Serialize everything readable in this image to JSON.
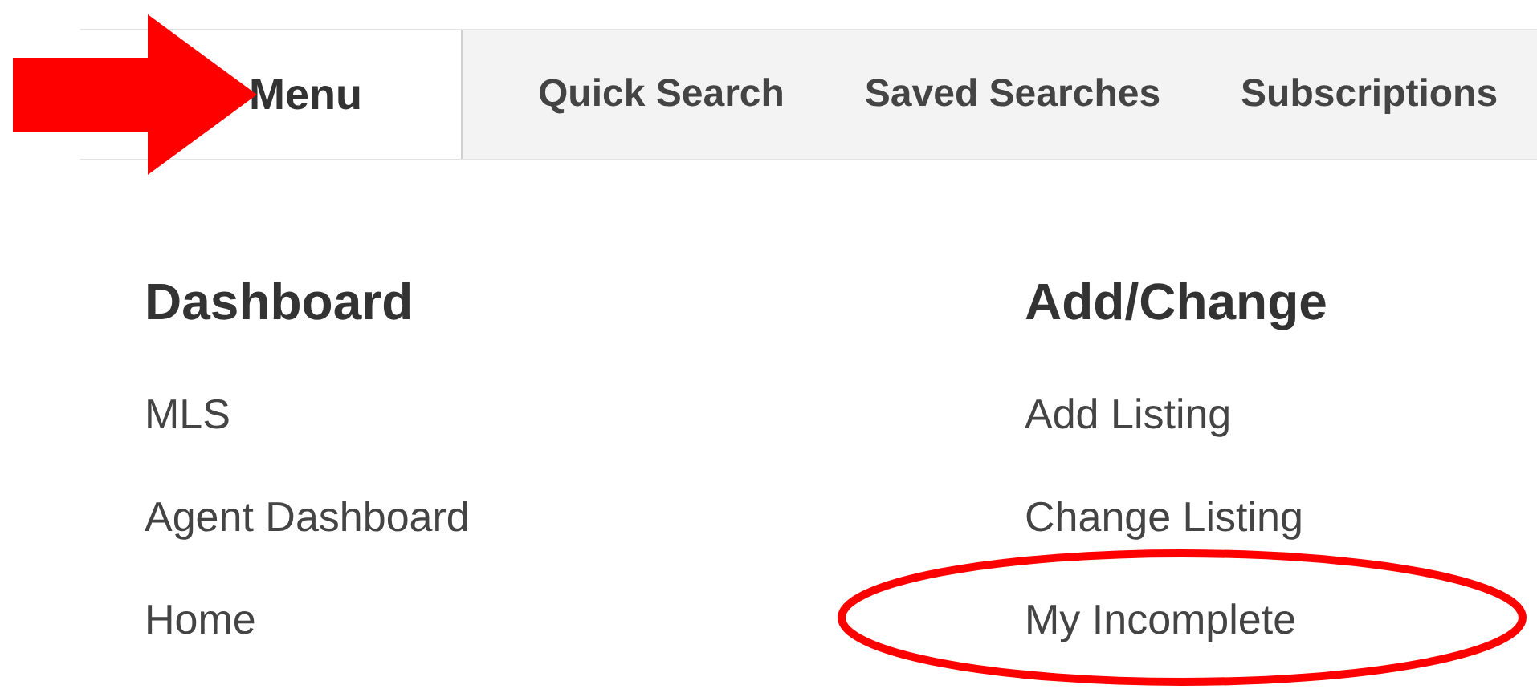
{
  "tabs": [
    {
      "label": "Menu",
      "selected": true,
      "arrow": true
    },
    {
      "label": "Quick Search",
      "selected": false,
      "arrow": false
    },
    {
      "label": "Saved Searches",
      "selected": false,
      "arrow": false
    },
    {
      "label": "Subscriptions",
      "selected": false,
      "arrow": false
    }
  ],
  "columns": [
    {
      "heading": "Dashboard",
      "items": [
        {
          "label": "MLS",
          "circled": false
        },
        {
          "label": "Agent Dashboard",
          "circled": false
        },
        {
          "label": "Home",
          "circled": false
        }
      ]
    },
    {
      "heading": "Add/Change",
      "items": [
        {
          "label": "Add Listing",
          "circled": false
        },
        {
          "label": "Change Listing",
          "circled": false
        },
        {
          "label": "My Incomplete",
          "circled": true
        }
      ]
    }
  ]
}
